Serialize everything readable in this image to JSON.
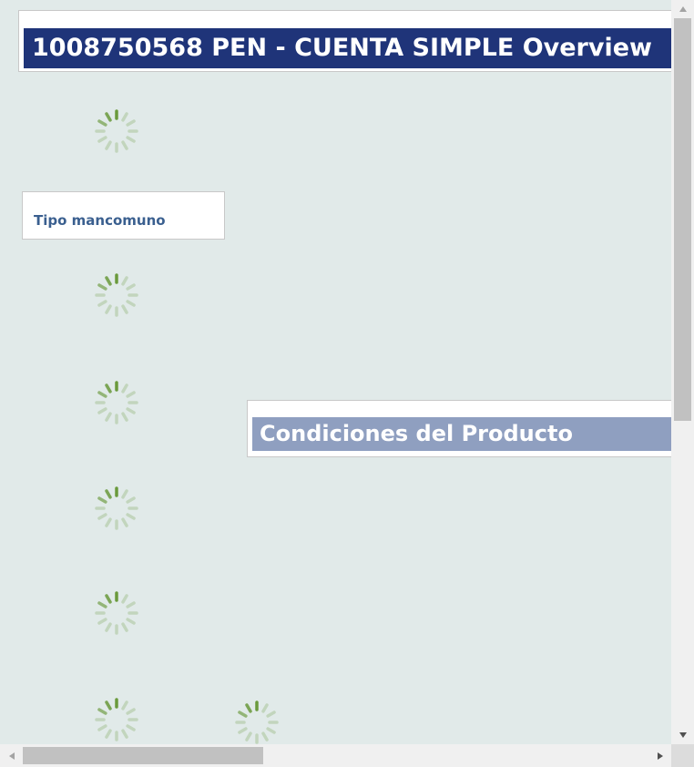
{
  "header": {
    "title": "1008750568 PEN - CUENTA SIMPLE Overview"
  },
  "type_panel": {
    "label": "Tipo mancomuno"
  },
  "conditions_panel": {
    "title": "Condiciones del Producto"
  },
  "loading_spinners": [
    {
      "icon": "loading-spinner-icon"
    },
    {
      "icon": "loading-spinner-icon"
    },
    {
      "icon": "loading-spinner-icon"
    },
    {
      "icon": "loading-spinner-icon"
    },
    {
      "icon": "loading-spinner-icon"
    },
    {
      "icon": "loading-spinner-icon"
    },
    {
      "icon": "loading-spinner-icon"
    }
  ],
  "colors": {
    "page_background": "#e1eae9",
    "header_title_background": "#1f3479",
    "conditions_title_background": "#8f9fc0",
    "type_label_text": "#3a5f8f",
    "spinner": "#6a9a3c"
  }
}
